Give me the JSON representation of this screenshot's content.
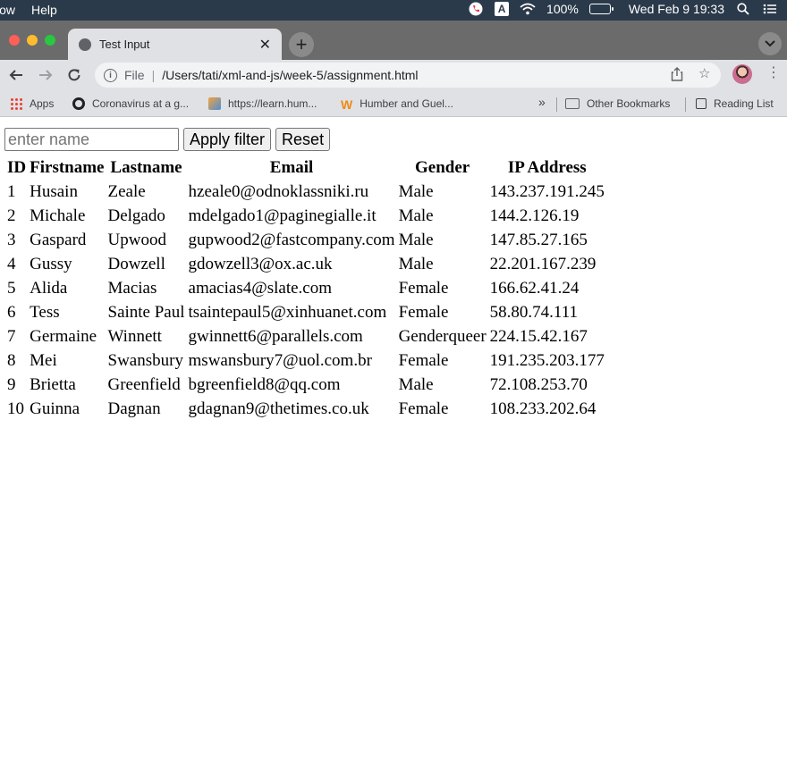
{
  "menubar": {
    "items": [
      "low",
      "Help"
    ],
    "battery": "100%",
    "clock": "Wed Feb 9  19:33"
  },
  "browser": {
    "tab_title": "Test Input",
    "scheme_label": "File",
    "url": "/Users/tati/xml-and-js/week-5/assignment.html",
    "bookmarks": [
      "Apps",
      "Coronavirus at a g...",
      "https://learn.hum...",
      "Humber and Guel..."
    ],
    "overflow": "»",
    "other_bookmarks": "Other Bookmarks",
    "reading_list": "Reading List"
  },
  "filter": {
    "placeholder": "enter name",
    "value": "",
    "apply_label": "Apply filter",
    "reset_label": "Reset"
  },
  "table": {
    "headers": [
      "ID",
      "Firstname",
      "Lastname",
      "Email",
      "Gender",
      "IP Address"
    ],
    "rows": [
      [
        "1",
        "Husain",
        "Zeale",
        "hzeale0@odnoklassniki.ru",
        "Male",
        "143.237.191.245"
      ],
      [
        "2",
        "Michale",
        "Delgado",
        "mdelgado1@paginegialle.it",
        "Male",
        "144.2.126.19"
      ],
      [
        "3",
        "Gaspard",
        "Upwood",
        "gupwood2@fastcompany.com",
        "Male",
        "147.85.27.165"
      ],
      [
        "4",
        "Gussy",
        "Dowzell",
        "gdowzell3@ox.ac.uk",
        "Male",
        "22.201.167.239"
      ],
      [
        "5",
        "Alida",
        "Macias",
        "amacias4@slate.com",
        "Female",
        "166.62.41.24"
      ],
      [
        "6",
        "Tess",
        "Sainte Paul",
        "tsaintepaul5@xinhuanet.com",
        "Female",
        "58.80.74.111"
      ],
      [
        "7",
        "Germaine",
        "Winnett",
        "gwinnett6@parallels.com",
        "Genderqueer",
        "224.15.42.167"
      ],
      [
        "8",
        "Mei",
        "Swansbury",
        "mswansbury7@uol.com.br",
        "Female",
        "191.235.203.177"
      ],
      [
        "9",
        "Brietta",
        "Greenfield",
        "bgreenfield8@qq.com",
        "Male",
        "72.108.253.70"
      ],
      [
        "10",
        "Guinna",
        "Dagnan",
        "gdagnan9@thetimes.co.uk",
        "Female",
        "108.233.202.64"
      ]
    ]
  }
}
